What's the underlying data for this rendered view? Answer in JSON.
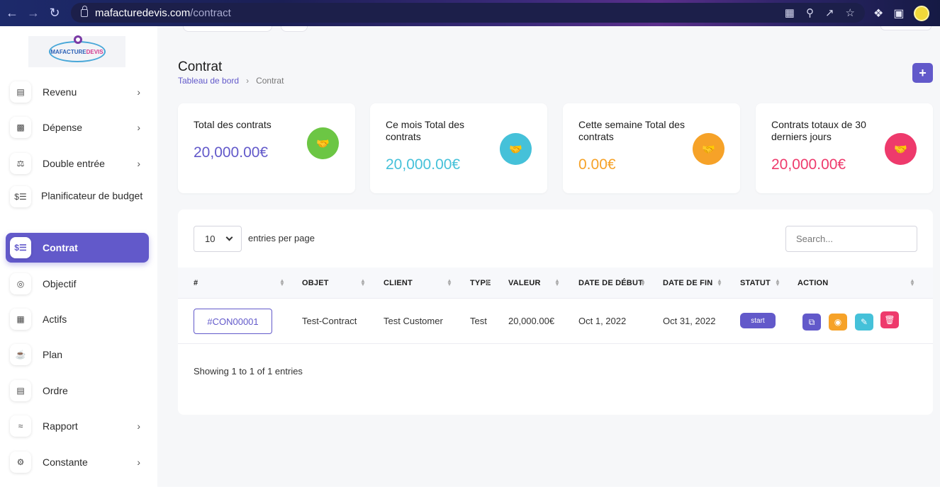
{
  "browser": {
    "url_host": "mafacturedevis.com",
    "url_path": "/contract"
  },
  "sidebar": {
    "logo_text_a": "MAFACTURE",
    "logo_text_b": "DEVIS",
    "items": [
      {
        "label": "Revenu"
      },
      {
        "label": "Dépense"
      },
      {
        "label": "Double entrée"
      },
      {
        "label": "Planificateur de budget"
      },
      {
        "label": "Contrat"
      },
      {
        "label": "Objectif"
      },
      {
        "label": "Actifs"
      },
      {
        "label": "Plan"
      },
      {
        "label": "Ordre"
      },
      {
        "label": "Rapport"
      },
      {
        "label": "Constante"
      }
    ]
  },
  "header": {
    "title": "Contrat",
    "breadcrumb_home": "Tableau de bord",
    "breadcrumb_current": "Contrat",
    "add_label": "+"
  },
  "cards": [
    {
      "title": "Total des contrats",
      "value": "20,000.00€",
      "color": "#6259ca",
      "icon_bg": "#6cc644"
    },
    {
      "title": "Ce mois Total des contrats",
      "value": "20,000.00€",
      "color": "#45c1d9",
      "icon_bg": "#45c1d9"
    },
    {
      "title": "Cette semaine Total des contrats",
      "value": "0.00€",
      "color": "#f6a228",
      "icon_bg": "#f6a228"
    },
    {
      "title": "Contrats totaux de 30 derniers jours",
      "value": "20,000.00€",
      "color": "#ee3a6c",
      "icon_bg": "#ee3a6c"
    }
  ],
  "table": {
    "per_page_value": "10",
    "per_page_label": "entries per page",
    "search_placeholder": "Search...",
    "columns": [
      "#",
      "OBJET",
      "CLIENT",
      "TYPE",
      "VALEUR",
      "DATE DE DÉBUT",
      "DATE DE FIN",
      "STATUT",
      "ACTION"
    ],
    "rows": [
      {
        "id": "#CON00001",
        "objet": "Test-Contract",
        "client": "Test Customer",
        "type": "Test",
        "valeur": "20,000.00€",
        "debut": "Oct 1, 2022",
        "fin": "Oct 31, 2022",
        "statut": "start"
      }
    ],
    "info": "Showing 1 to 1 of 1 entries"
  },
  "colors": {
    "accent": "#6259ca",
    "copy": "#6259ca",
    "view": "#f6a228",
    "edit": "#45c1d9",
    "delete": "#ee3a6c"
  },
  "icons": {
    "card": "handshake-icon",
    "actions": [
      "copy-icon",
      "eye-icon",
      "edit-icon",
      "trash-icon"
    ]
  }
}
